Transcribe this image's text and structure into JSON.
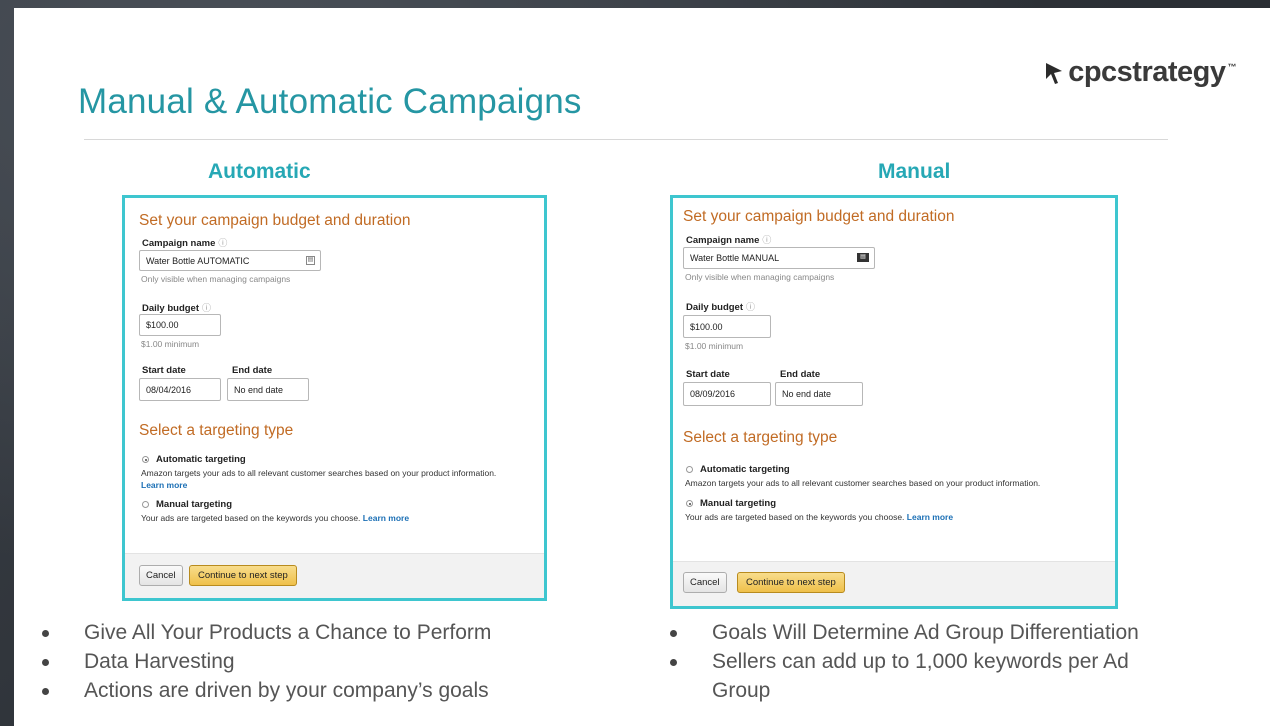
{
  "slide": {
    "title": "Manual & Automatic Campaigns",
    "logo": {
      "text": "cpcstrategy",
      "tm": "™"
    }
  },
  "automatic": {
    "heading": "Automatic",
    "panel_title": "Set your campaign budget and duration",
    "campaign_name_label": "Campaign name",
    "campaign_name_value": "Water Bottle AUTOMATIC",
    "campaign_name_note": "Only visible when managing campaigns",
    "daily_budget_label": "Daily budget",
    "daily_budget_value": "$100.00",
    "daily_budget_note": "$1.00 minimum",
    "start_date_label": "Start date",
    "start_date_value": "08/04/2016",
    "end_date_label": "End date",
    "end_date_value": "No end date",
    "targeting_title": "Select a targeting type",
    "auto_targeting_label": "Automatic targeting",
    "auto_targeting_desc": "Amazon targets your ads to all relevant customer searches based on your product information.",
    "auto_learn_more": "Learn more",
    "manual_targeting_label": "Manual targeting",
    "manual_targeting_desc": "Your ads are targeted based on the keywords you choose.",
    "manual_learn_more": "Learn more",
    "cancel_label": "Cancel",
    "continue_label": "Continue to next step",
    "selected": "automatic"
  },
  "manual": {
    "heading": "Manual",
    "panel_title": "Set your campaign budget and duration",
    "campaign_name_label": "Campaign name",
    "campaign_name_value": "Water Bottle MANUAL",
    "campaign_name_note": "Only visible when managing campaigns",
    "daily_budget_label": "Daily budget",
    "daily_budget_value": "$100.00",
    "daily_budget_note": "$1.00 minimum",
    "start_date_label": "Start date",
    "start_date_value": "08/09/2016",
    "end_date_label": "End date",
    "end_date_value": "No end date",
    "targeting_title": "Select a targeting type",
    "auto_targeting_label": "Automatic targeting",
    "auto_targeting_desc": "Amazon targets your ads to all relevant customer searches based on your product information.",
    "manual_targeting_label": "Manual targeting",
    "manual_targeting_desc": "Your ads are targeted based on the keywords you choose.",
    "manual_learn_more": "Learn more",
    "cancel_label": "Cancel",
    "continue_label": "Continue to next step",
    "selected": "manual"
  },
  "bullets_left": [
    "Give All Your Products a Chance to Perform",
    "Data Harvesting",
    "Actions are driven by your company’s goals"
  ],
  "bullets_right": [
    "Goals Will Determine Ad Group Differentiation",
    "Sellers can add up to 1,000 keywords per Ad Group"
  ],
  "colors": {
    "accent": "#2596a3",
    "panel_border": "#3ec6cf",
    "orange_heading": "#c16b24",
    "link": "#1b6fb5"
  }
}
